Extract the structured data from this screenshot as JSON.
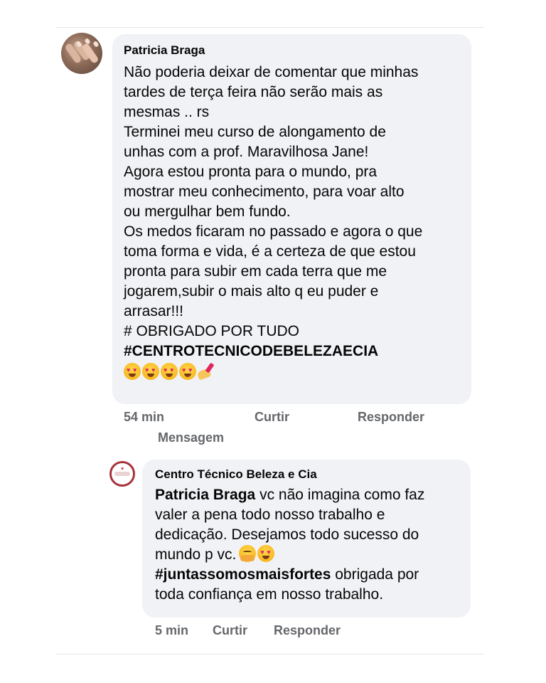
{
  "comment": {
    "author": "Patricia Braga",
    "lines": [
      "Não poderia deixar de comentar que minhas",
      "tardes de terça feira não serão mais as",
      "mesmas .. rs",
      "Terminei meu curso de alongamento de",
      "unhas com a prof. Maravilhosa Jane!",
      "Agora estou pronta para o mundo, pra",
      "mostrar meu conhecimento, para voar alto",
      "ou mergulhar bem fundo.",
      "Os medos ficaram no passado e agora o que",
      "toma forma e vida, é a certeza de que estou",
      "pronta para subir em cada terra que me",
      "jogarem,subir o mais alto q eu puder e",
      "arrasar!!!",
      "# OBRIGADO POR TUDO"
    ],
    "hashtag": "#CENTROTECNICODEBELEZAECIA",
    "emojis": [
      "heart-eyes",
      "heart-eyes",
      "heart-eyes",
      "heart-eyes",
      "nail-polish"
    ],
    "time": "54 min",
    "like_label": "Curtir",
    "reply_label": "Responder",
    "message_label": "Mensagem"
  },
  "reply": {
    "author": "Centro Técnico Beleza e Cia",
    "mention": "Patricia Braga",
    "line1_rest": " vc não imagina como faz",
    "line2": "valer a pena todo nosso trabalho e",
    "line3": "dedicação. Desejamos todo sucesso do",
    "line4": "mundo p vc.",
    "hashtag": "#juntassomosmaisfortes",
    "line5_rest": " obrigada por",
    "line6": "toda confiança em nosso trabalho.",
    "emojis": [
      "hugging-face",
      "heart-eyes"
    ],
    "time": "5 min",
    "like_label": "Curtir",
    "reply_label": "Responder"
  }
}
